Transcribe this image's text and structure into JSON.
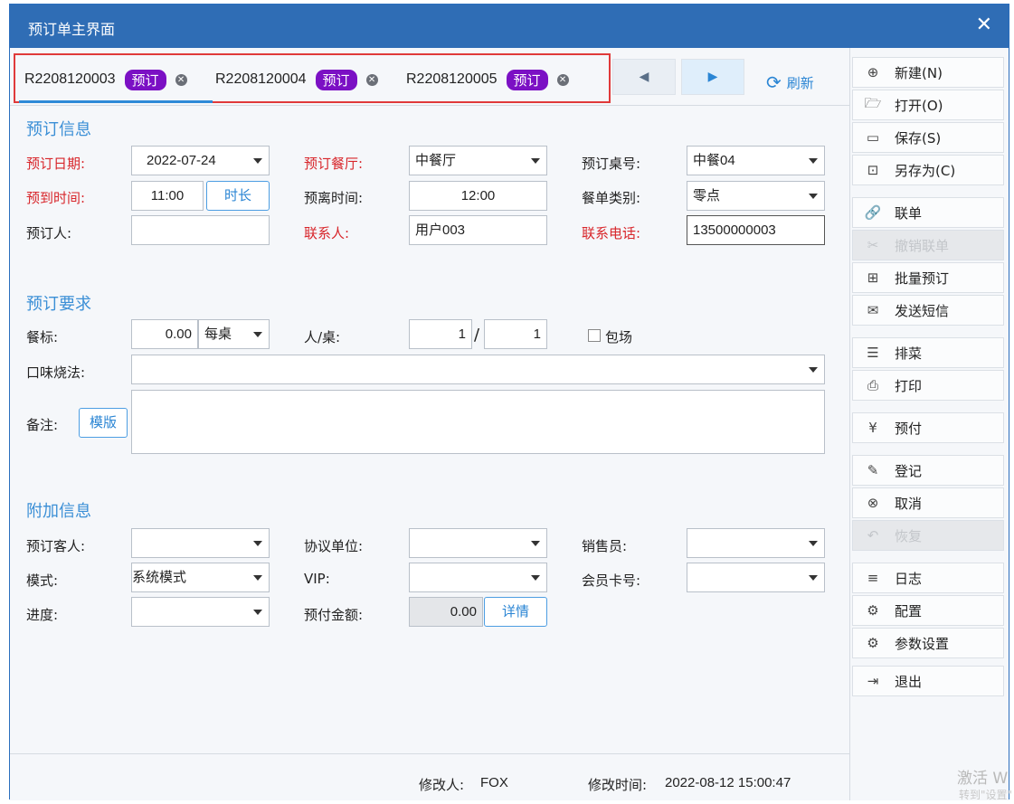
{
  "window": {
    "title": "预订单主界面",
    "close_glyph": "✕"
  },
  "tabs": [
    {
      "id": "R2208120003",
      "badge": "预订"
    },
    {
      "id": "R2208120004",
      "badge": "预订"
    },
    {
      "id": "R2208120005",
      "badge": "预订"
    }
  ],
  "nav": {
    "prev": "◀",
    "next": "▶",
    "refresh": "刷新"
  },
  "sections": {
    "info": "预订信息",
    "require": "预订要求",
    "extra": "附加信息"
  },
  "form": {
    "date": {
      "label": "预订日期:",
      "value": "2022-07-24"
    },
    "arrive": {
      "label": "预到时间:",
      "value": "11:00",
      "button": "时长"
    },
    "booker": {
      "label": "预订人:",
      "value": ""
    },
    "hall": {
      "label": "预订餐厅:",
      "value": "中餐厅"
    },
    "leave": {
      "label": "预离时间:",
      "value": "12:00"
    },
    "contact": {
      "label": "联系人:",
      "value": "用户003"
    },
    "table_no": {
      "label": "预订桌号:",
      "value": "中餐04"
    },
    "menu_type": {
      "label": "餐单类别:",
      "value": "零点"
    },
    "phone": {
      "label": "联系电话:",
      "value": "13500000003"
    },
    "standard": {
      "label": "餐标:",
      "value": "0.00",
      "unit": "每桌"
    },
    "people": {
      "label": "人/桌:",
      "value1": "1",
      "sep": "/",
      "value2": "1"
    },
    "whole": {
      "label": "包场"
    },
    "taste": {
      "label": "口味烧法:",
      "value": ""
    },
    "remark": {
      "label": "备注:",
      "button": "模版",
      "value": ""
    },
    "guest": {
      "label": "预订客人:",
      "value": ""
    },
    "agreement": {
      "label": "协议单位:",
      "value": ""
    },
    "sales": {
      "label": "销售员:",
      "value": ""
    },
    "mode": {
      "label": "模式:",
      "value": "系统模式"
    },
    "vip": {
      "label": "VIP:",
      "value": ""
    },
    "card": {
      "label": "会员卡号:",
      "value": ""
    },
    "progress": {
      "label": "进度:",
      "value": ""
    },
    "prepay": {
      "label": "预付金额:",
      "value": "0.00",
      "button": "详情"
    }
  },
  "footer": {
    "modifier_label": "修改人:",
    "modifier": "FOX",
    "time_label": "修改时间:",
    "time": "2022-08-12 15:00:47"
  },
  "menu": [
    {
      "label": "新建(N)",
      "icon": "⊕",
      "disabled": false
    },
    {
      "label": "打开(O)",
      "icon": "🗁",
      "disabled": false
    },
    {
      "label": "保存(S)",
      "icon": "▭",
      "disabled": false
    },
    {
      "label": "另存为(C)",
      "icon": "⊡",
      "disabled": false
    },
    {
      "label": "联单",
      "icon": "🔗",
      "disabled": false
    },
    {
      "label": "撤销联单",
      "icon": "✂",
      "disabled": true
    },
    {
      "label": "批量预订",
      "icon": "⊞",
      "disabled": false
    },
    {
      "label": "发送短信",
      "icon": "✉",
      "disabled": false
    },
    {
      "label": "排菜",
      "icon": "☰",
      "disabled": false
    },
    {
      "label": "打印",
      "icon": "⎙",
      "disabled": false
    },
    {
      "label": "预付",
      "icon": "¥",
      "disabled": false
    },
    {
      "label": "登记",
      "icon": "✎",
      "disabled": false
    },
    {
      "label": "取消",
      "icon": "⊗",
      "disabled": false
    },
    {
      "label": "恢复",
      "icon": "↶",
      "disabled": true
    },
    {
      "label": "日志",
      "icon": "≡",
      "disabled": false
    },
    {
      "label": "配置",
      "icon": "⚙",
      "disabled": false
    },
    {
      "label": "参数设置",
      "icon": "⚙",
      "disabled": false
    },
    {
      "label": "退出",
      "icon": "⇥",
      "disabled": false
    }
  ],
  "watermark": {
    "line1": "激活 W",
    "line2": "转到\"设置\""
  }
}
